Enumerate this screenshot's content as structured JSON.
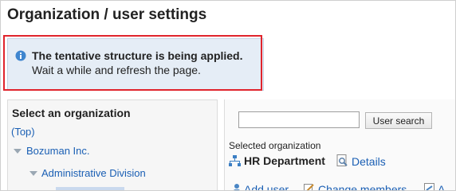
{
  "page": {
    "title": "Organization / user settings"
  },
  "notice": {
    "title": "The tentative structure is being applied.",
    "message": "Wait a while and refresh the page."
  },
  "left": {
    "heading": "Select an organization",
    "tree": [
      {
        "label": "(Top)"
      },
      {
        "label": "Bozuman Inc."
      },
      {
        "label": "Administrative Division"
      }
    ]
  },
  "right": {
    "search": {
      "value": "",
      "button_label": "User search"
    },
    "selected_label": "Selected organization",
    "selected_org": "HR Department",
    "details_label": "Details",
    "actions": [
      {
        "label": "Add user"
      },
      {
        "label": "Change members"
      },
      {
        "label": "A"
      }
    ]
  },
  "colors": {
    "highlight_border": "#e0242c",
    "notice_bg": "#e5edf6",
    "link": "#1a5fb4"
  },
  "icons": [
    "info-icon",
    "organization-icon",
    "details-icon",
    "add-user-icon",
    "change-members-icon",
    "action-icon"
  ]
}
